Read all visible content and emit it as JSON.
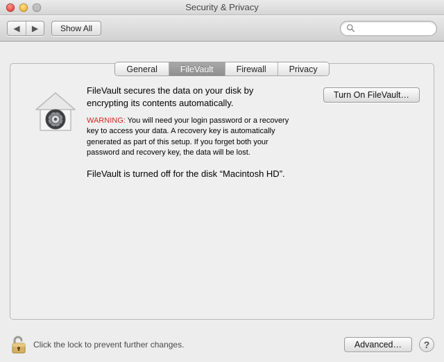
{
  "window": {
    "title": "Security & Privacy"
  },
  "toolbar": {
    "back_aria": "Back",
    "forward_aria": "Forward",
    "show_all": "Show All",
    "search_placeholder": ""
  },
  "tabs": [
    {
      "label": "General",
      "active": false
    },
    {
      "label": "FileVault",
      "active": true
    },
    {
      "label": "Firewall",
      "active": false
    },
    {
      "label": "Privacy",
      "active": false
    }
  ],
  "filevault": {
    "intro": "FileVault secures the data on your disk by encrypting its contents automatically.",
    "warning_label": "WARNING:",
    "warning_body": "You will need your login password or a recovery key to access your data. A recovery key is automatically generated as part of this setup. If you forget both your password and recovery key, the data will be lost.",
    "status": "FileVault is turned off for the disk “Macintosh HD”.",
    "turn_on_button": "Turn On FileVault…"
  },
  "footer": {
    "lock_hint": "Click the lock to prevent further changes.",
    "advanced_button": "Advanced…",
    "help_label": "?"
  }
}
